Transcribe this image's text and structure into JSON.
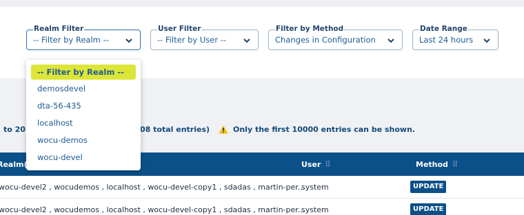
{
  "filters": {
    "realm": {
      "label": "Realm Filter",
      "value": "-- Filter by Realm --"
    },
    "user": {
      "label": "User Filter",
      "value": "-- Filter by User --"
    },
    "method": {
      "label": "Filter by Method",
      "value": "Changes in Configuration"
    },
    "date": {
      "label": "Date Range",
      "value": "Last 24 hours"
    }
  },
  "status": {
    "range_prefix": "to ",
    "range_to": "20",
    "range_suffix": "08 total entries)",
    "warning": "Only the first 10000 entries can be shown."
  },
  "table": {
    "headers": {
      "realm": "Realm(s",
      "user": "User",
      "method": "Method"
    },
    "rows": [
      {
        "realms": "wocu-devel2 , wocudemos , localhost , wocu-devel-copy1 , sdadas , martin-per...",
        "user": "system",
        "method": "UPDATE"
      },
      {
        "realms": "wocu-devel2 , wocudemos , localhost , wocu-devel-copy1 , sdadas , martin-per...",
        "user": "system",
        "method": "UPDATE"
      }
    ]
  },
  "realm_dropdown": {
    "options": [
      "-- Filter by Realm --",
      "demosdevel",
      "dta-56-435",
      "localhost",
      "wocu-demos",
      "wocu-devel"
    ]
  },
  "icons": {
    "chevron": "chevron-down-icon",
    "warning": "warning-icon",
    "grip": "drag-grip-icon"
  },
  "colors": {
    "accent": "#0c5089",
    "highlight": "#dde638",
    "warning": "#f2c200"
  }
}
